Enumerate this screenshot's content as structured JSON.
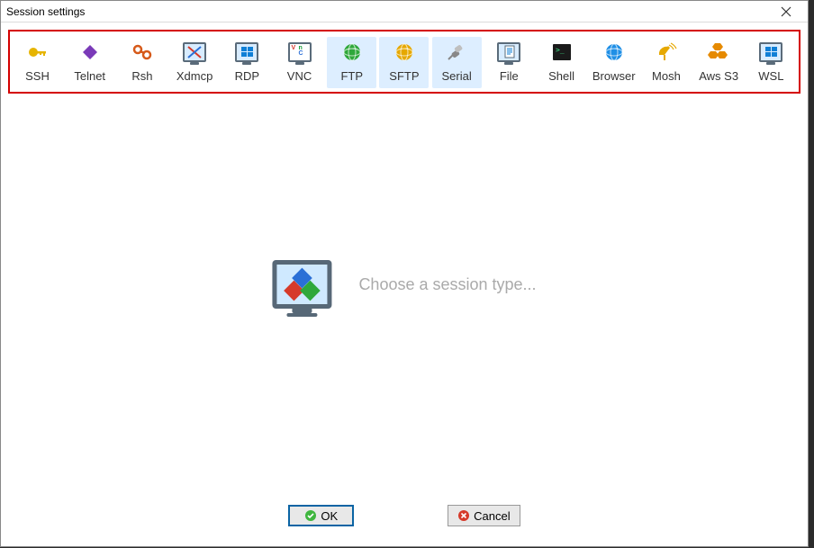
{
  "window": {
    "title": "Session settings"
  },
  "toolbar": {
    "items": [
      {
        "id": "ssh",
        "label": "SSH",
        "icon": "key-icon",
        "color": "#e6b400",
        "selected": false
      },
      {
        "id": "telnet",
        "label": "Telnet",
        "icon": "diamond-icon",
        "color": "#7a3ab8",
        "selected": false
      },
      {
        "id": "rsh",
        "label": "Rsh",
        "icon": "link-icon",
        "color": "#d65a1a",
        "selected": false
      },
      {
        "id": "xdmcp",
        "label": "Xdmcp",
        "icon": "x-monitor-icon",
        "color": "#5a6b7a",
        "selected": false
      },
      {
        "id": "rdp",
        "label": "RDP",
        "icon": "win-monitor-icon",
        "color": "#0f7fd6",
        "selected": false
      },
      {
        "id": "vnc",
        "label": "VNC",
        "icon": "vnc-monitor-icon",
        "color": "#d6332a",
        "selected": false
      },
      {
        "id": "ftp",
        "label": "FTP",
        "icon": "globe-icon",
        "color": "#2fa83b",
        "selected": true
      },
      {
        "id": "sftp",
        "label": "SFTP",
        "icon": "globe-icon",
        "color": "#e6a800",
        "selected": true
      },
      {
        "id": "serial",
        "label": "Serial",
        "icon": "plug-icon",
        "color": "#888888",
        "selected": true
      },
      {
        "id": "file",
        "label": "File",
        "icon": "doc-monitor-icon",
        "color": "#0f7fd6",
        "selected": false
      },
      {
        "id": "shell",
        "label": "Shell",
        "icon": "terminal-icon",
        "color": "#1a1a1a",
        "selected": false
      },
      {
        "id": "browser",
        "label": "Browser",
        "icon": "globe-icon",
        "color": "#1f8fe6",
        "selected": false
      },
      {
        "id": "mosh",
        "label": "Mosh",
        "icon": "dish-icon",
        "color": "#e6a800",
        "selected": false
      },
      {
        "id": "awss3",
        "label": "Aws S3",
        "icon": "hex-icon",
        "color": "#e68a00",
        "selected": false
      },
      {
        "id": "wsl",
        "label": "WSL",
        "icon": "win-monitor-icon",
        "color": "#0f7fd6",
        "selected": false
      }
    ]
  },
  "main": {
    "prompt": "Choose a session type..."
  },
  "buttons": {
    "ok": "OK",
    "cancel": "Cancel"
  }
}
